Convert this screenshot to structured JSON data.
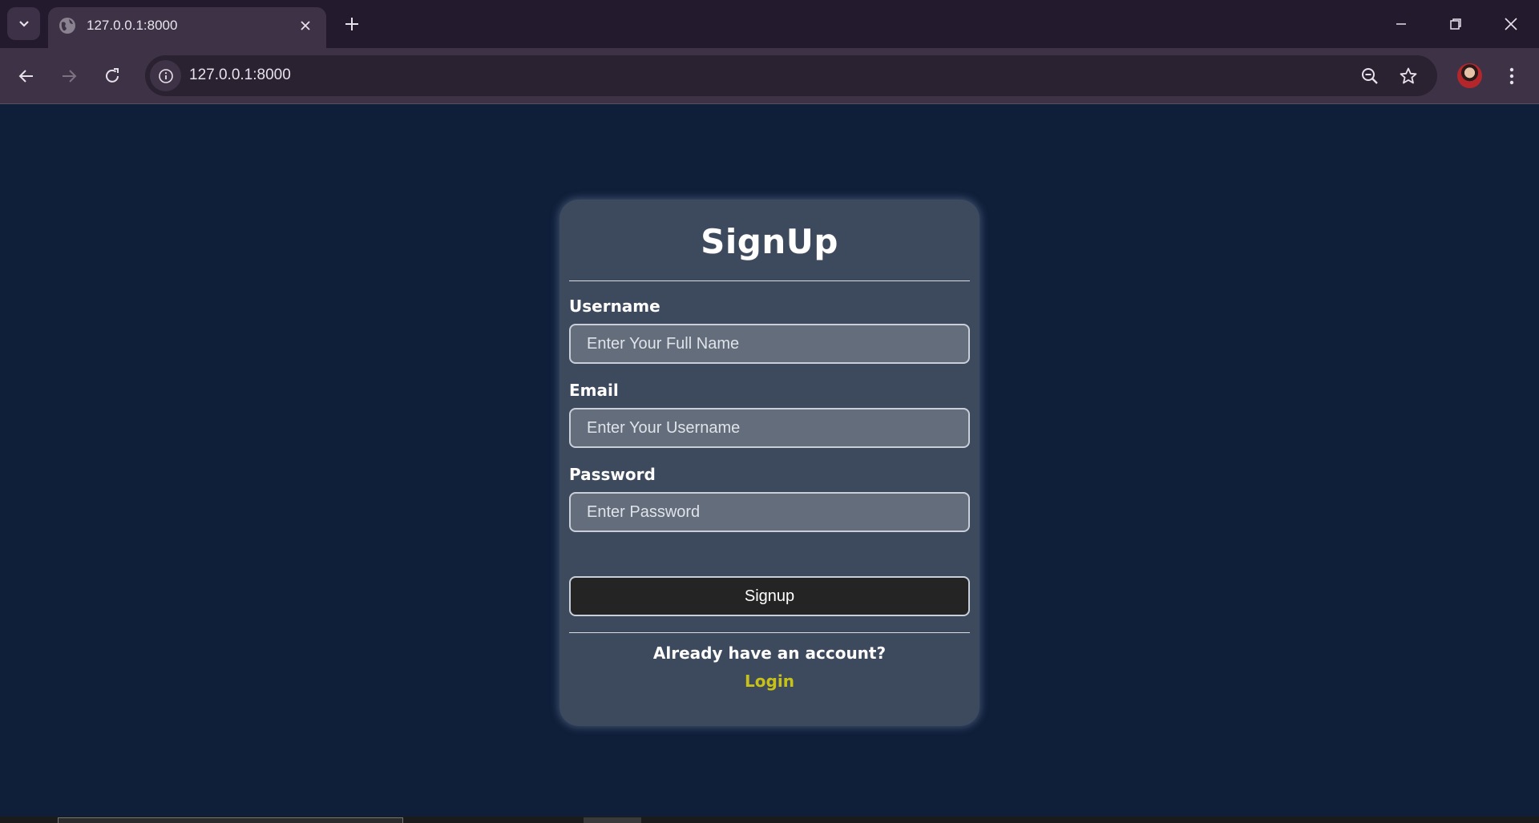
{
  "browser": {
    "tab": {
      "title": "127.0.0.1:8000"
    },
    "address_bar": {
      "url": "127.0.0.1:8000"
    }
  },
  "page": {
    "title": "SignUp",
    "fields": [
      {
        "label": "Username",
        "placeholder": "Enter Your Full Name"
      },
      {
        "label": "Email",
        "placeholder": "Enter Your Username"
      },
      {
        "label": "Password",
        "placeholder": "Enter Password"
      }
    ],
    "submit_label": "Signup",
    "prompt": "Already have an account?",
    "login_label": "Login"
  },
  "colors": {
    "page_background": "#0f1f3a",
    "card_background": "#3d4a5d",
    "login_link": "#c8c218",
    "button_background": "#242424"
  },
  "icons": [
    "tab-search-icon",
    "globe-icon",
    "close-icon",
    "plus-icon",
    "minimize-icon",
    "restore-icon",
    "window-close-icon",
    "back-arrow-icon",
    "forward-arrow-icon",
    "reload-icon",
    "info-icon",
    "zoom-out-icon",
    "star-icon",
    "kebab-menu-icon"
  ]
}
